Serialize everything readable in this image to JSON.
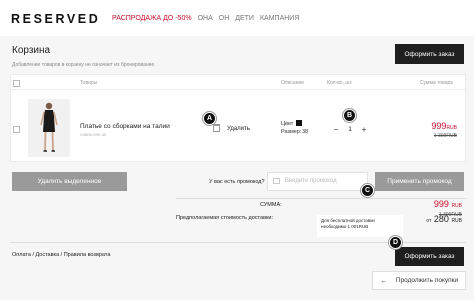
{
  "header": {
    "logo": "RESERVED",
    "nav": [
      {
        "label": "РАСПРОДАЖА ДО -50%",
        "accent": true
      },
      {
        "label": "ОНА"
      },
      {
        "label": "ОН"
      },
      {
        "label": "ДЕТИ"
      },
      {
        "label": "КАМПАНИЯ"
      }
    ]
  },
  "cart": {
    "title": "Корзина",
    "subtitle": "Добавление товаров в корзину не означает их бронирование",
    "checkout_label": "Оформить заказ",
    "columns": {
      "products": "Товары",
      "description": "Описание",
      "quantity": "Кол-во, шт.",
      "total": "Сумма товара"
    },
    "item": {
      "name": "Платье со сборками на талии",
      "code": "V4B05-99X-30",
      "delete_label": "Удалить",
      "color_label": "Цвет",
      "size_label": "Размер:",
      "size_value": "38",
      "quantity": "1",
      "minus": "−",
      "plus": "+",
      "price": "999",
      "price_currency": "RUB",
      "old_price": "1 399RUB"
    },
    "delete_selected_label": "Удалить выделенное",
    "promo_question": "У вас есть промокод?",
    "promo_placeholder": "Введите промокод",
    "apply_promo_label": "Применить промокод",
    "summary": {
      "sum_label": "СУММА:",
      "sum_value": "999",
      "sum_currency": "RUB",
      "sum_old": "1 399RUB",
      "shipping_label": "Предполагаемая стоимость доставки:",
      "shipping_note": "Для бесплатной доставки необходимо 1 001RUB",
      "shipping_prefix": "от",
      "shipping_value": "280",
      "shipping_currency": "RUB"
    },
    "footer_links": "Оплата / Доставка / Правила возврата",
    "continue_label": "Продолжить покупки",
    "continue_arrow": "←"
  },
  "markers": [
    "A",
    "B",
    "C",
    "D"
  ],
  "colors": {
    "accent": "#c8102e",
    "dark_button": "#1f1f1f",
    "grey_button": "#9a9a9a"
  }
}
